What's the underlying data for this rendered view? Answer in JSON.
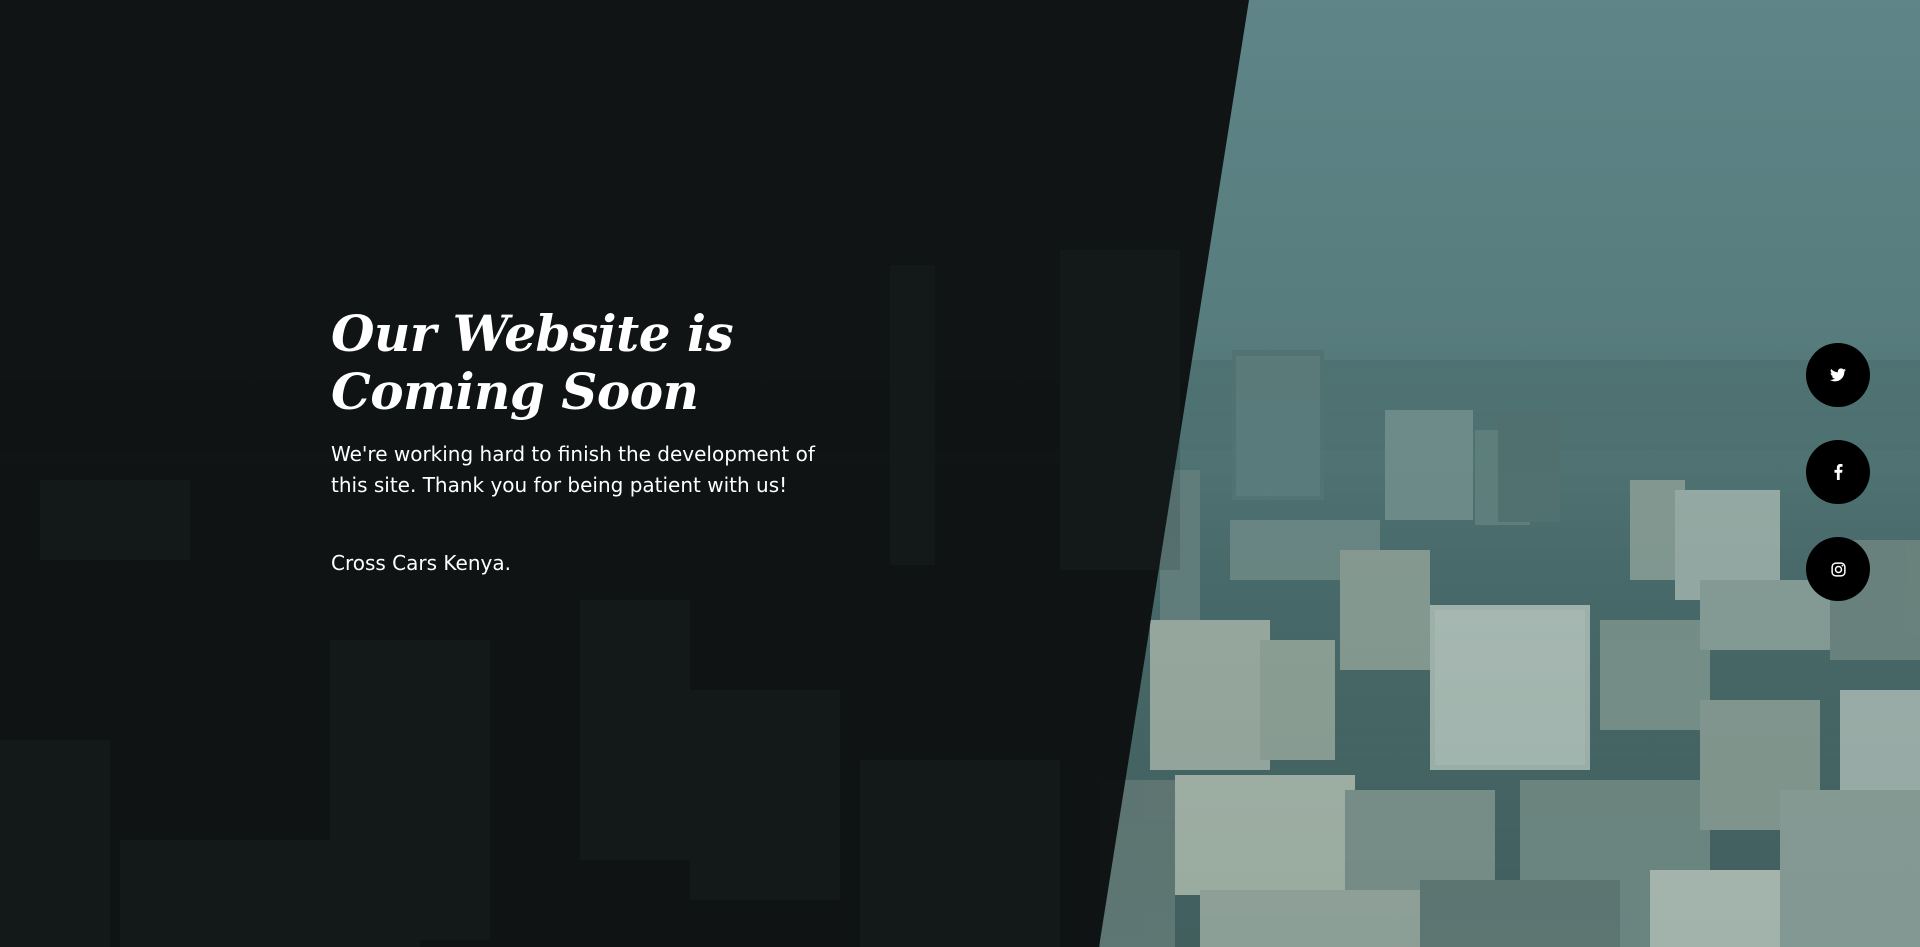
{
  "hero": {
    "title_line1": "Our Website is",
    "title_line2": "Coming Soon",
    "description": "We're working hard to finish the development of this site. Thank you for being patient with us!",
    "company": "Cross Cars Kenya."
  },
  "social": [
    {
      "icon": "twitter-icon"
    },
    {
      "icon": "facebook-icon"
    },
    {
      "icon": "instagram-icon"
    }
  ],
  "colors": {
    "dark_panel": "#0e1111",
    "sky": "#5f8486",
    "social_bg": "#000000",
    "text": "#ffffff"
  }
}
